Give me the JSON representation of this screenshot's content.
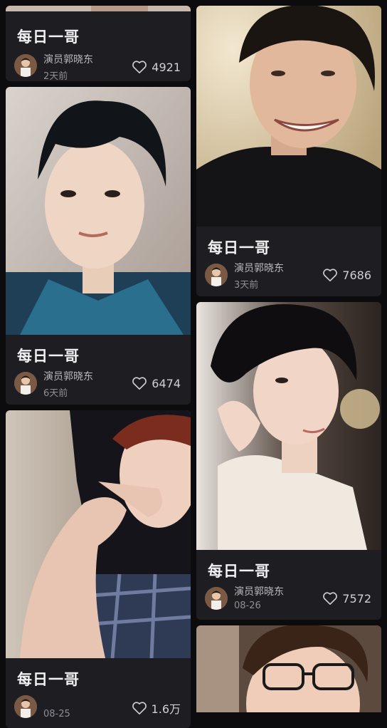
{
  "feed": {
    "cards": [
      {
        "id": "c1",
        "title": "每日一哥",
        "author": "演员郭晓东",
        "time": "2天前",
        "likes": "4921"
      },
      {
        "id": "c2",
        "title": "每日一哥",
        "author": "演员郭晓东",
        "time": "6天前",
        "likes": "6474"
      },
      {
        "id": "c3",
        "title": "每日一哥",
        "author": "",
        "time": "08-25",
        "likes": "1.6万"
      },
      {
        "id": "c4",
        "title": "每日一哥",
        "author": "演员郭晓东",
        "time": "3天前",
        "likes": "7686"
      },
      {
        "id": "c5",
        "title": "每日一哥",
        "author": "演员郭晓东",
        "time": "08-26",
        "likes": "7572"
      }
    ]
  },
  "icons": {
    "like": "heart-outline-icon",
    "avatar": "avatar-photo"
  },
  "colors": {
    "background": "#0c0c0e",
    "card": "#1e1e22",
    "title_text": "#f1f1f3",
    "meta_text": "#b9b9be"
  }
}
